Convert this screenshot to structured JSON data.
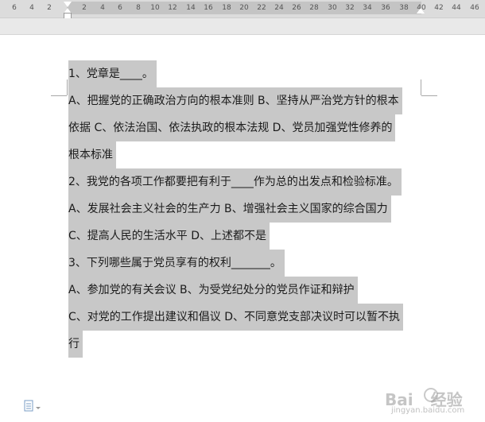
{
  "ruler": {
    "ticks": [
      "6",
      "4",
      "2",
      "2",
      "4",
      "6",
      "8",
      "10",
      "12",
      "14",
      "16",
      "18",
      "20",
      "22",
      "24",
      "26",
      "28",
      "30",
      "32",
      "34",
      "36",
      "38",
      "40",
      "42",
      "44",
      "46"
    ]
  },
  "document": {
    "lines": [
      "1、党章是____。",
      "A、把握党的正确政治方向的根本准则 B、坚持从严治党方针的根本",
      "依据   C、依法治国、依法执政的根本法规 D、党员加强党性修养的",
      "根本标准",
      "2、我党的各项工作都要把有利于____作为总的出发点和检验标准。",
      "A、发展社会主义社会的生产力 B、增强社会主义国家的综合国力",
      "C、提高人民的生活水平  D、上述都不是",
      "3、下列哪些属于党员享有的权利_______。",
      "A、参加党的有关会议 B、为受党纪处分的党员作证和辩护",
      "C、对党的工作提出建议和倡议 D、不同意党支部决议时可以暂不执",
      "行"
    ]
  },
  "watermark": {
    "brand": "Bai",
    "brand2": "经验",
    "url": "jingyan.baidu.com"
  },
  "icons": {
    "paste_options": "paste-options-icon"
  }
}
